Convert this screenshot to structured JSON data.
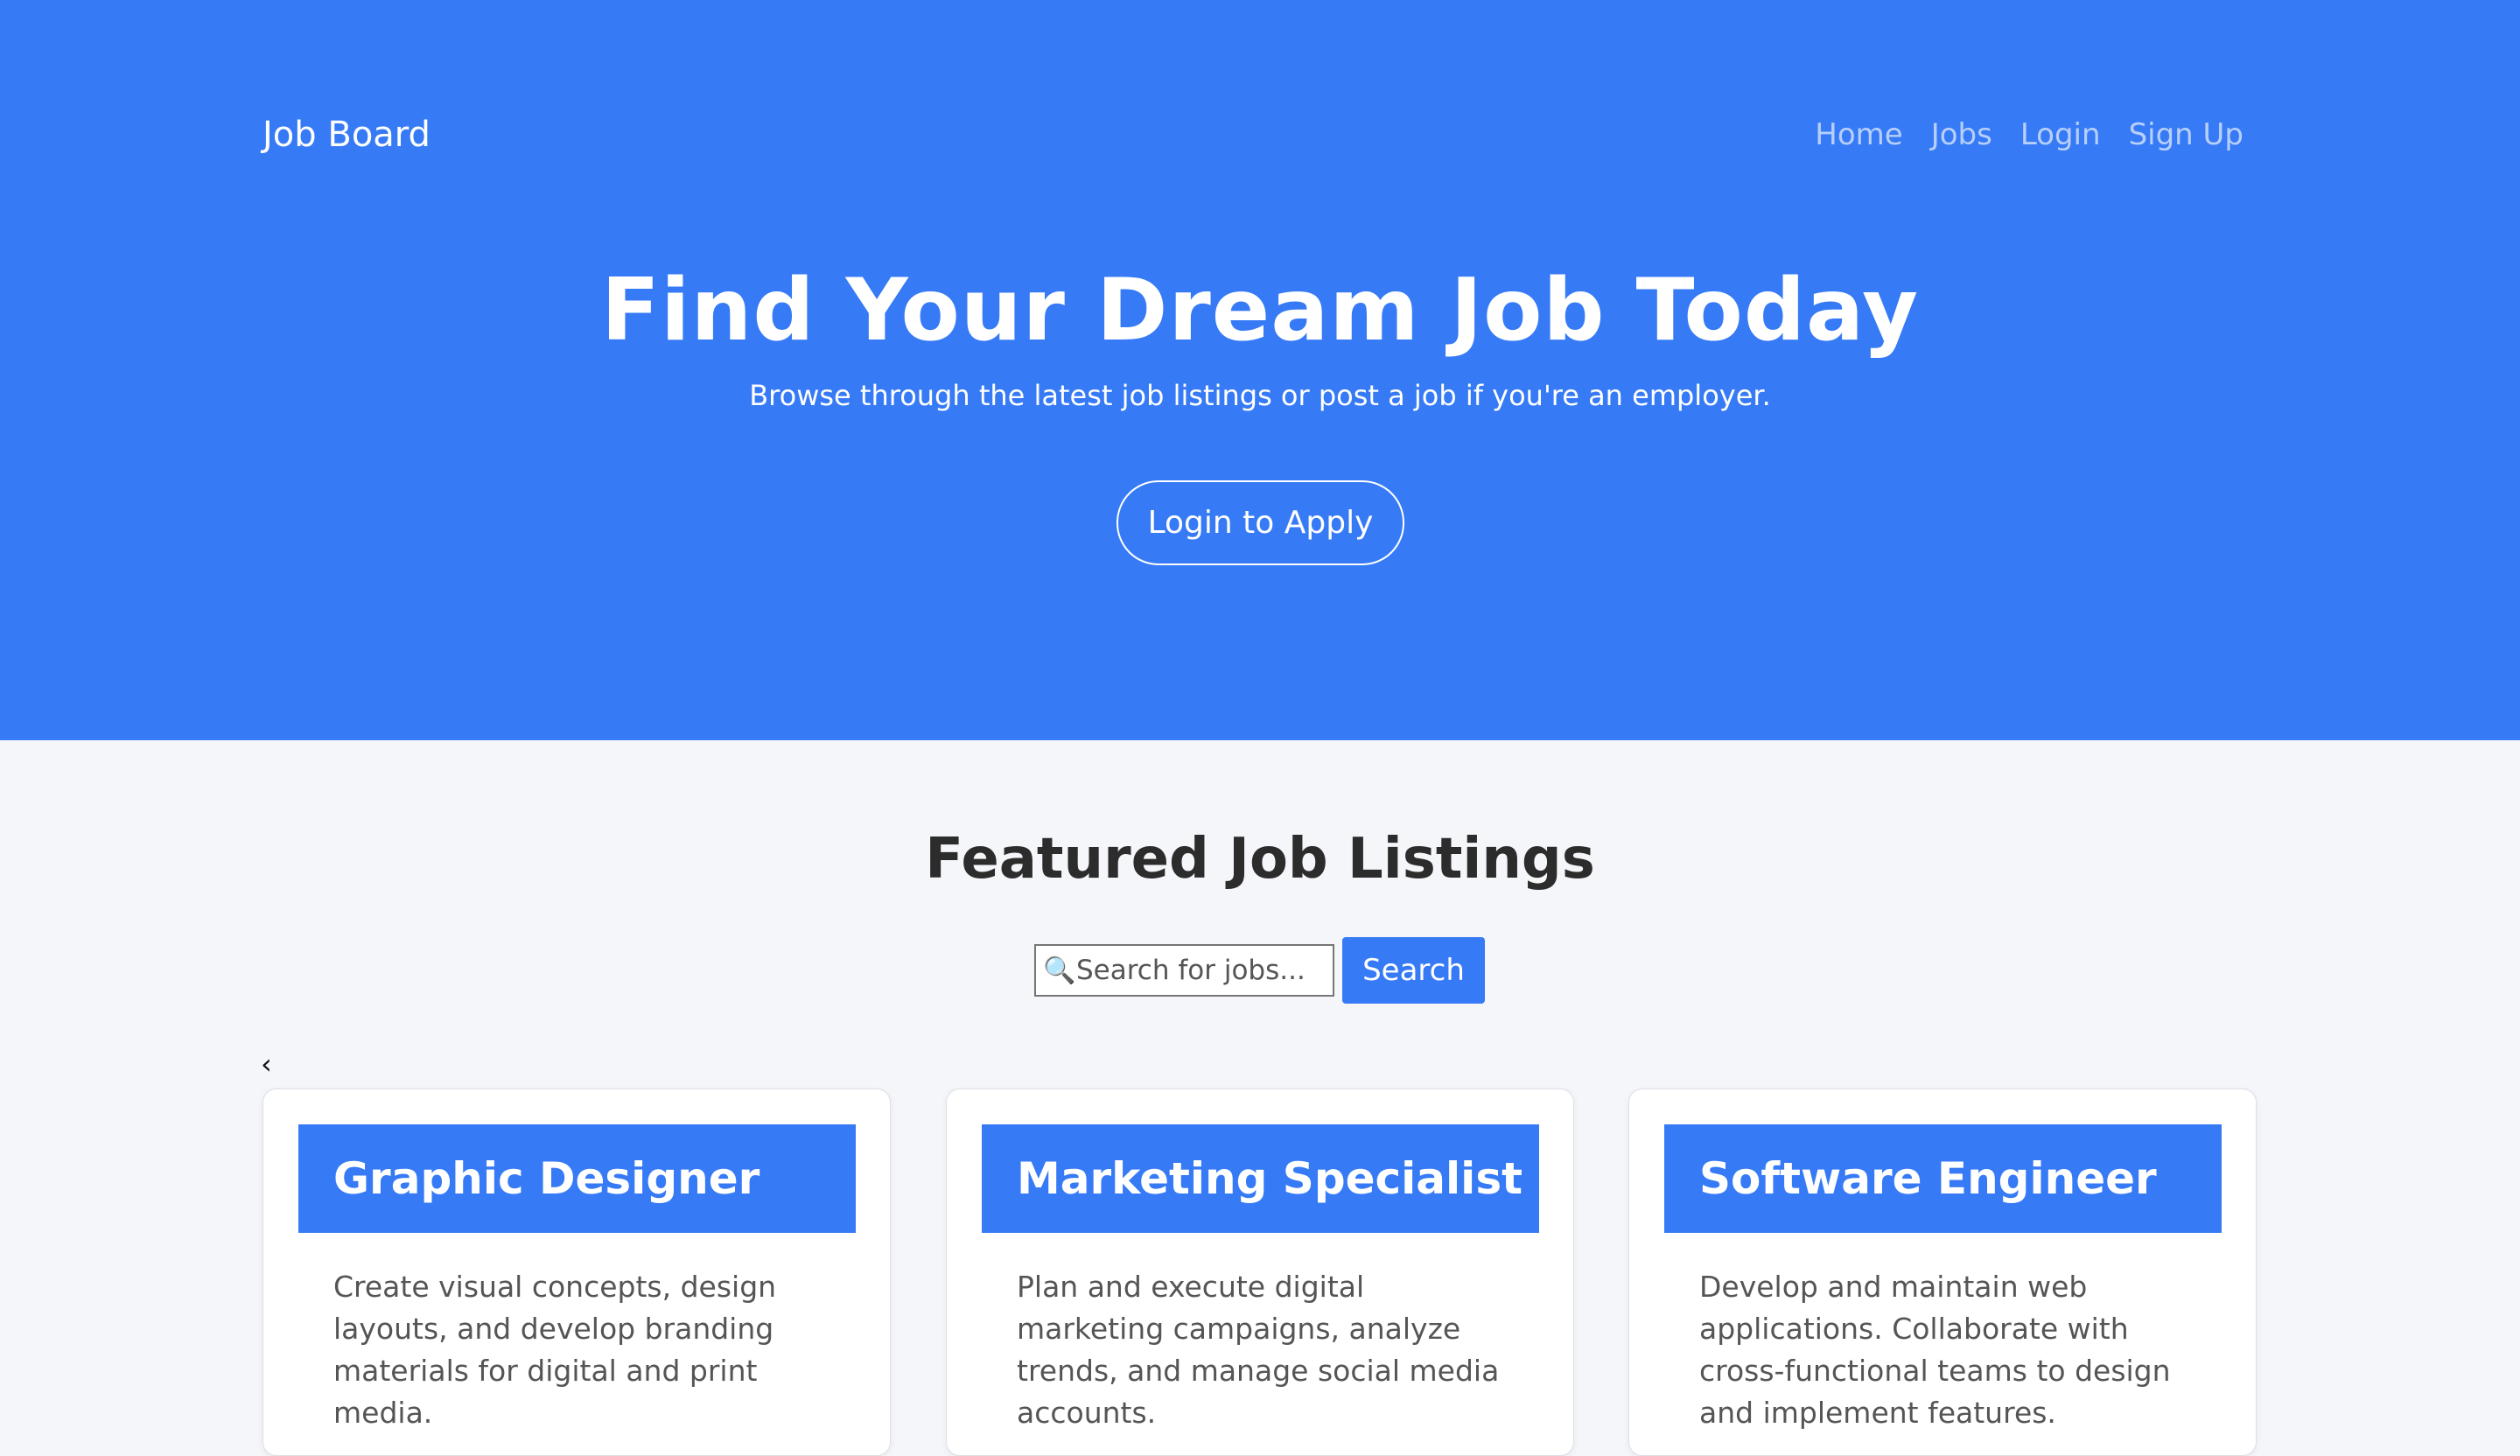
{
  "header": {
    "brand": "Job Board",
    "nav": [
      "Home",
      "Jobs",
      "Login",
      "Sign Up"
    ]
  },
  "hero": {
    "title": "Find Your Dream Job Today",
    "subtitle": "Browse through the latest job listings or post a job if you're an employer.",
    "cta_label": "Login to Apply"
  },
  "listings": {
    "section_title": "Featured Job Listings",
    "search_placeholder": "Search for jobs...",
    "search_icon": "🔍",
    "search_button": "Search",
    "prev_icon": "‹",
    "jobs": [
      {
        "title": "Graphic Designer",
        "description": "Create visual concepts, design layouts, and develop branding materials for digital and print media."
      },
      {
        "title": "Marketing Specialist",
        "description": "Plan and execute digital marketing campaigns, analyze trends, and manage social media accounts."
      },
      {
        "title": "Software Engineer",
        "description": "Develop and maintain web applications. Collaborate with cross-functional teams to design and implement features."
      }
    ]
  },
  "colors": {
    "primary": "#367af6",
    "page_bg": "#f4f6fa",
    "nav_link": "#b7cffb"
  }
}
